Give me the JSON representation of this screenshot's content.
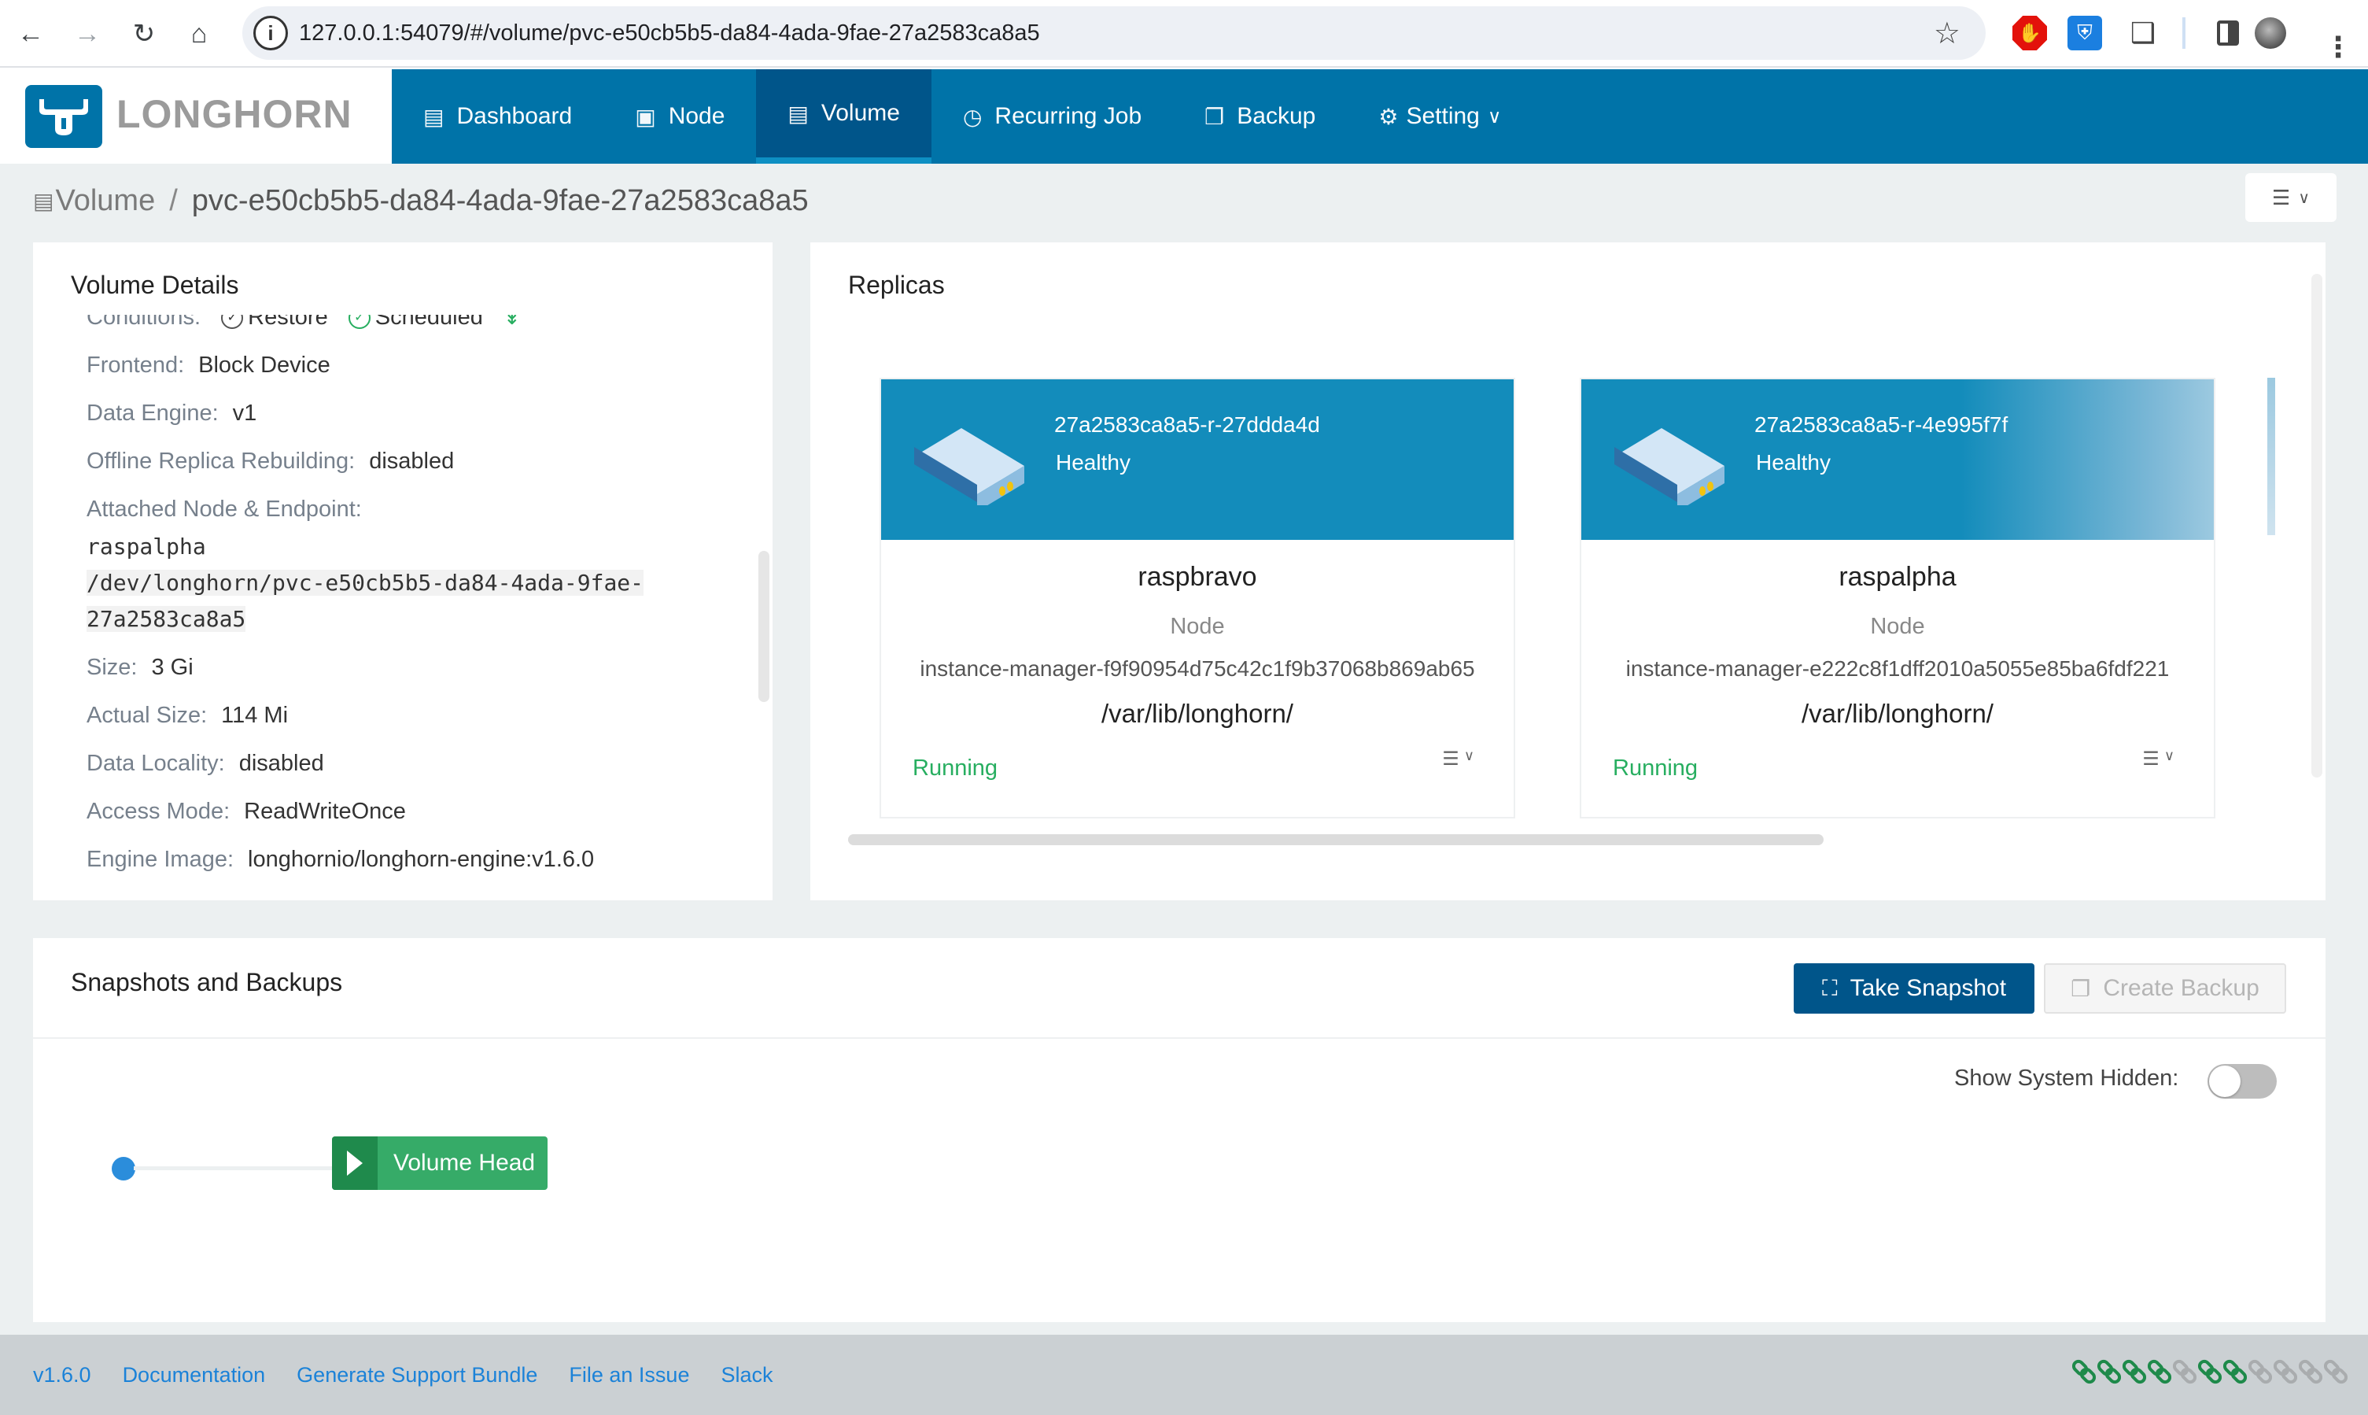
{
  "browser": {
    "url": "127.0.0.1:54079/#/volume/pvc-e50cb5b5-da84-4ada-9fae-27a2583ca8a5",
    "nav_icons": [
      "back-icon",
      "forward-icon",
      "reload-icon",
      "home-icon"
    ],
    "extensions": [
      "adblock-icon",
      "bitwarden-icon",
      "extensions-puzzle-icon",
      "side-panel-icon",
      "profile-avatar",
      "menu-kebab-icon"
    ]
  },
  "app": {
    "logo_text": "LONGHORN",
    "brand_color": "#0073a8",
    "menu": [
      {
        "label": "Dashboard",
        "icon": "bar-chart-icon",
        "active": false
      },
      {
        "label": "Node",
        "icon": "laptop-icon",
        "active": false
      },
      {
        "label": "Volume",
        "icon": "database-icon",
        "active": true
      },
      {
        "label": "Recurring Job",
        "icon": "clock-icon",
        "active": false
      },
      {
        "label": "Backup",
        "icon": "copy-icon",
        "active": false
      },
      {
        "label": "Setting",
        "icon": "gear-icon",
        "active": false,
        "dropdown": true
      }
    ]
  },
  "breadcrumb": {
    "parent": "Volume",
    "separator": "/",
    "current": "pvc-e50cb5b5-da84-4ada-9fae-27a2583ca8a5"
  },
  "volume_details": {
    "title": "Volume Details",
    "conditions_label": "Conditions:",
    "conditions": [
      {
        "label": "Restore",
        "state": "ok"
      },
      {
        "label": "Scheduled",
        "state": "ok-green"
      }
    ],
    "rows": [
      {
        "key": "Frontend:",
        "value": "Block Device"
      },
      {
        "key": "Data Engine:",
        "value": "v1"
      },
      {
        "key": "Offline Replica Rebuilding:",
        "value": "disabled"
      }
    ],
    "attached_label": "Attached Node & Endpoint:",
    "attached_node": "raspalpha",
    "endpoint_line1": "/dev/longhorn/pvc-e50cb5b5-da84-4ada-9fae-",
    "endpoint_line2": "27a2583ca8a5",
    "rows2": [
      {
        "key": "Size:",
        "value": "3 Gi"
      },
      {
        "key": "Actual Size:",
        "value": "114 Mi"
      },
      {
        "key": "Data Locality:",
        "value": "disabled"
      },
      {
        "key": "Access Mode:",
        "value": "ReadWriteOnce"
      },
      {
        "key": "Engine Image:",
        "value": "longhornio/longhorn-engine:v1.6.0"
      }
    ]
  },
  "replicas": {
    "title": "Replicas",
    "items": [
      {
        "name": "27a2583ca8a5-r-27ddda4d",
        "health": "Healthy",
        "node": "raspbravo",
        "node_label": "Node",
        "instance_manager": "instance-manager-f9f90954d75c42c1f9b37068b869ab65",
        "path": "/var/lib/longhorn/",
        "status": "Running"
      },
      {
        "name": "27a2583ca8a5-r-4e995f7f",
        "health": "Healthy",
        "node": "raspalpha",
        "node_label": "Node",
        "instance_manager": "instance-manager-e222c8f1dff2010a5055e85ba6fdf221",
        "path": "/var/lib/longhorn/",
        "status": "Running"
      }
    ]
  },
  "snapshots": {
    "title": "Snapshots and Backups",
    "take_snapshot": "Take Snapshot",
    "create_backup": "Create Backup",
    "show_hidden_label": "Show System Hidden:",
    "show_hidden": false,
    "volume_head": "Volume Head"
  },
  "footer": {
    "links": [
      "v1.6.0",
      "Documentation",
      "Generate Support Bundle",
      "File an Issue",
      "Slack"
    ],
    "connection_status": [
      "connected",
      "connected",
      "connected",
      "connected",
      "disconnected",
      "connected",
      "connected",
      "disconnected",
      "disconnected",
      "disconnected",
      "disconnected"
    ],
    "colors": {
      "connected": "#1e8a4a",
      "disconnected": "#a9acae"
    }
  }
}
